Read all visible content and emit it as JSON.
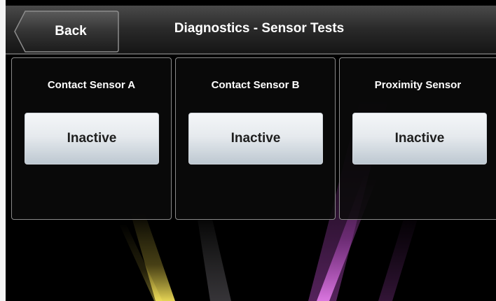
{
  "header": {
    "back_label": "Back",
    "title": "Diagnostics - Sensor Tests"
  },
  "sensors": [
    {
      "name": "Contact Sensor A",
      "status": "Inactive"
    },
    {
      "name": "Contact Sensor B",
      "status": "Inactive"
    },
    {
      "name": "Proximity Sensor",
      "status": "Inactive"
    }
  ],
  "colors": {
    "header_top": "#4a4a4a",
    "header_bottom": "#141414",
    "panel_border": "#8a8a8a",
    "button_top": "#f4f6f8",
    "button_bottom": "#bdc8d1",
    "accent_yellow": "#e8d34a",
    "accent_magenta": "#c04fc6"
  }
}
